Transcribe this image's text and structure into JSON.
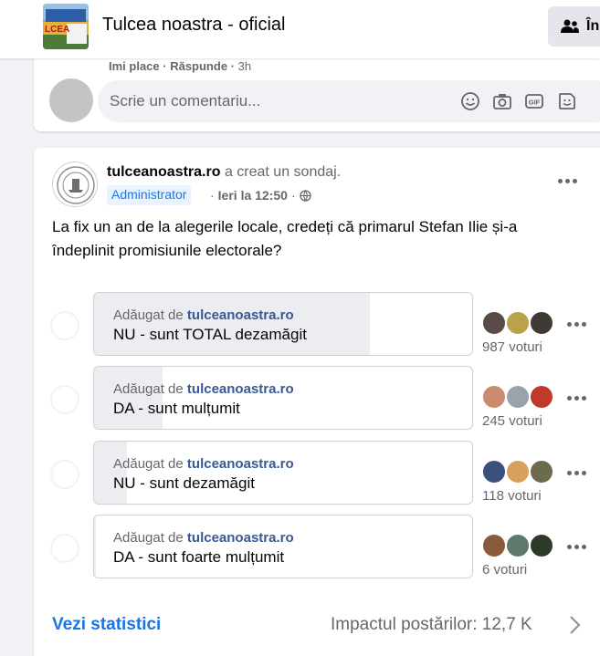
{
  "header": {
    "group_name": "Tulcea noastra - oficial",
    "join_label": "În",
    "thumb_text": "LCEA"
  },
  "comment_area": {
    "like_label": "Imi place",
    "sep": " · ",
    "reply_label": "Răspunde",
    "time": "3h",
    "placeholder": "Scrie un comentariu...",
    "icons": [
      "smile-icon",
      "camera-icon",
      "gif-icon",
      "sticker-icon"
    ]
  },
  "post": {
    "author": "tulceanoastra.ro",
    "action": "a creat un sondaj.",
    "badge": "Administrator",
    "time_prefix": " · ",
    "time": "Ieri la 12:50",
    "time_suffix": " · ",
    "text": "La fix un an de la alegerile locale, credeți că primarul Stefan Ilie și-a îndeplinit promisiunile electorale?"
  },
  "poll": {
    "added_by_prefix": "Adăugat de",
    "added_by_name": "tulceanoastra.ro",
    "options": [
      {
        "label": "NU - sunt TOTAL dezamăgit",
        "votes": "987 voturi",
        "share": 0.729
      },
      {
        "label": "DA - sunt mulțumit",
        "votes": "245 voturi",
        "share": 0.181
      },
      {
        "label": "NU - sunt dezamăgit",
        "votes": "118 voturi",
        "share": 0.087
      },
      {
        "label": "DA - sunt foarte mulțumit",
        "votes": "6 voturi",
        "share": 0.004
      }
    ]
  },
  "footer": {
    "see_stats": "Vezi statistici",
    "impact": "Impactul postărilor: 12,7 K"
  },
  "colors": {
    "link_blue": "#1b74e4",
    "name_blue": "#385898",
    "badge_bg": "#e7f3ff",
    "fill_gray": "#ebedf0"
  }
}
